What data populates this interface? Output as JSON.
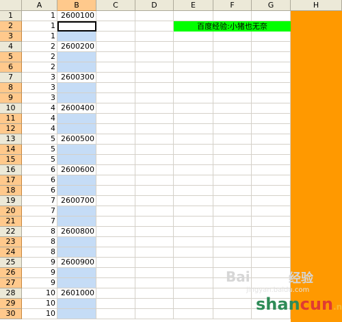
{
  "sheet": {
    "columns": [
      "A",
      "B",
      "C",
      "D",
      "E",
      "F",
      "G",
      "H"
    ],
    "selected_column": "B",
    "rows": [
      {
        "row": "1",
        "a": "1",
        "b": "2600100"
      },
      {
        "row": "2",
        "a": "1",
        "b": ""
      },
      {
        "row": "3",
        "a": "1",
        "b": ""
      },
      {
        "row": "4",
        "a": "2",
        "b": "2600200"
      },
      {
        "row": "5",
        "a": "2",
        "b": ""
      },
      {
        "row": "6",
        "a": "2",
        "b": ""
      },
      {
        "row": "7",
        "a": "3",
        "b": "2600300"
      },
      {
        "row": "8",
        "a": "3",
        "b": ""
      },
      {
        "row": "9",
        "a": "3",
        "b": ""
      },
      {
        "row": "10",
        "a": "4",
        "b": "2600400"
      },
      {
        "row": "11",
        "a": "4",
        "b": ""
      },
      {
        "row": "12",
        "a": "4",
        "b": ""
      },
      {
        "row": "13",
        "a": "5",
        "b": "2600500"
      },
      {
        "row": "14",
        "a": "5",
        "b": ""
      },
      {
        "row": "15",
        "a": "5",
        "b": ""
      },
      {
        "row": "16",
        "a": "6",
        "b": "2600600"
      },
      {
        "row": "17",
        "a": "6",
        "b": ""
      },
      {
        "row": "18",
        "a": "6",
        "b": ""
      },
      {
        "row": "19",
        "a": "7",
        "b": "2600700"
      },
      {
        "row": "20",
        "a": "7",
        "b": ""
      },
      {
        "row": "21",
        "a": "7",
        "b": ""
      },
      {
        "row": "22",
        "a": "8",
        "b": "2600800"
      },
      {
        "row": "23",
        "a": "8",
        "b": ""
      },
      {
        "row": "24",
        "a": "8",
        "b": ""
      },
      {
        "row": "25",
        "a": "9",
        "b": "2600900"
      },
      {
        "row": "26",
        "a": "9",
        "b": ""
      },
      {
        "row": "27",
        "a": "9",
        "b": ""
      },
      {
        "row": "28",
        "a": "10",
        "b": "2601000"
      },
      {
        "row": "29",
        "a": "10",
        "b": ""
      },
      {
        "row": "30",
        "a": "10",
        "b": ""
      }
    ],
    "selected_rows": [
      "2",
      "3",
      "5",
      "6",
      "8",
      "9",
      "11",
      "12",
      "14",
      "15",
      "17",
      "18",
      "20",
      "21",
      "23",
      "24",
      "26",
      "27",
      "29",
      "30"
    ],
    "active_cell": "B2",
    "banner_text": "百度经验:小猪也无奈",
    "banner_color": "#00ff00",
    "column_h_color": "#ff9900",
    "selection_color": "#c5dcf6"
  },
  "watermark": {
    "baidu": "Bai",
    "jingyan": "经验",
    "url": "jingyan.baidu.com",
    "shan": "shan",
    "cun": "cun",
    "net": ".net"
  }
}
